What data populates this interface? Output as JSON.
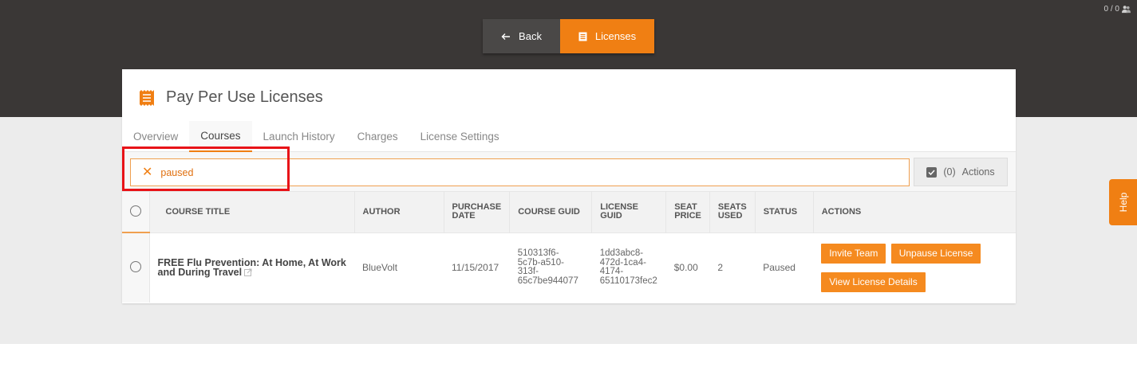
{
  "header": {
    "user_count": "0 / 0",
    "nav": {
      "back_label": "Back",
      "licenses_label": "Licenses"
    }
  },
  "page": {
    "title": "Pay Per Use Licenses"
  },
  "tabs": [
    {
      "label": "Overview"
    },
    {
      "label": "Courses"
    },
    {
      "label": "Launch History"
    },
    {
      "label": "Charges"
    },
    {
      "label": "License Settings"
    }
  ],
  "active_tab": "Courses",
  "filter": {
    "value": "paused"
  },
  "actions_button": {
    "count": "(0)",
    "label": "Actions"
  },
  "table": {
    "headers": {
      "course_title": "COURSE TITLE",
      "author": "AUTHOR",
      "purchase_date_1": "PURCHASE",
      "purchase_date_2": "DATE",
      "course_guid": "COURSE GUID",
      "license_guid_1": "LICENSE",
      "license_guid_2": "GUID",
      "seat_price_1": "SEAT",
      "seat_price_2": "PRICE",
      "seats_used_1": "SEATS",
      "seats_used_2": "USED",
      "status": "STATUS",
      "actions": "ACTIONS"
    },
    "rows": [
      {
        "course_title_1": "FREE Flu Prevention: At Home, At Work",
        "course_title_2": "and During Travel",
        "author": "BlueVolt",
        "purchase_date": "11/15/2017",
        "course_guid": [
          "510313f6-",
          "5c7b-a510-",
          "313f-",
          "65c7be944077"
        ],
        "license_guid": [
          "1dd3abc8-",
          "472d-1ca4-",
          "4174-",
          "65110173fec2"
        ],
        "seat_price": "$0.00",
        "seats_used": "2",
        "status": "Paused",
        "actions": {
          "invite": "Invite Team",
          "unpause": "Unpause License",
          "view": "View License Details"
        }
      }
    ]
  },
  "help": {
    "label": "Help"
  },
  "colors": {
    "accent": "#f07f13",
    "header_bg": "#3a3736",
    "highlight": "#e81318"
  }
}
